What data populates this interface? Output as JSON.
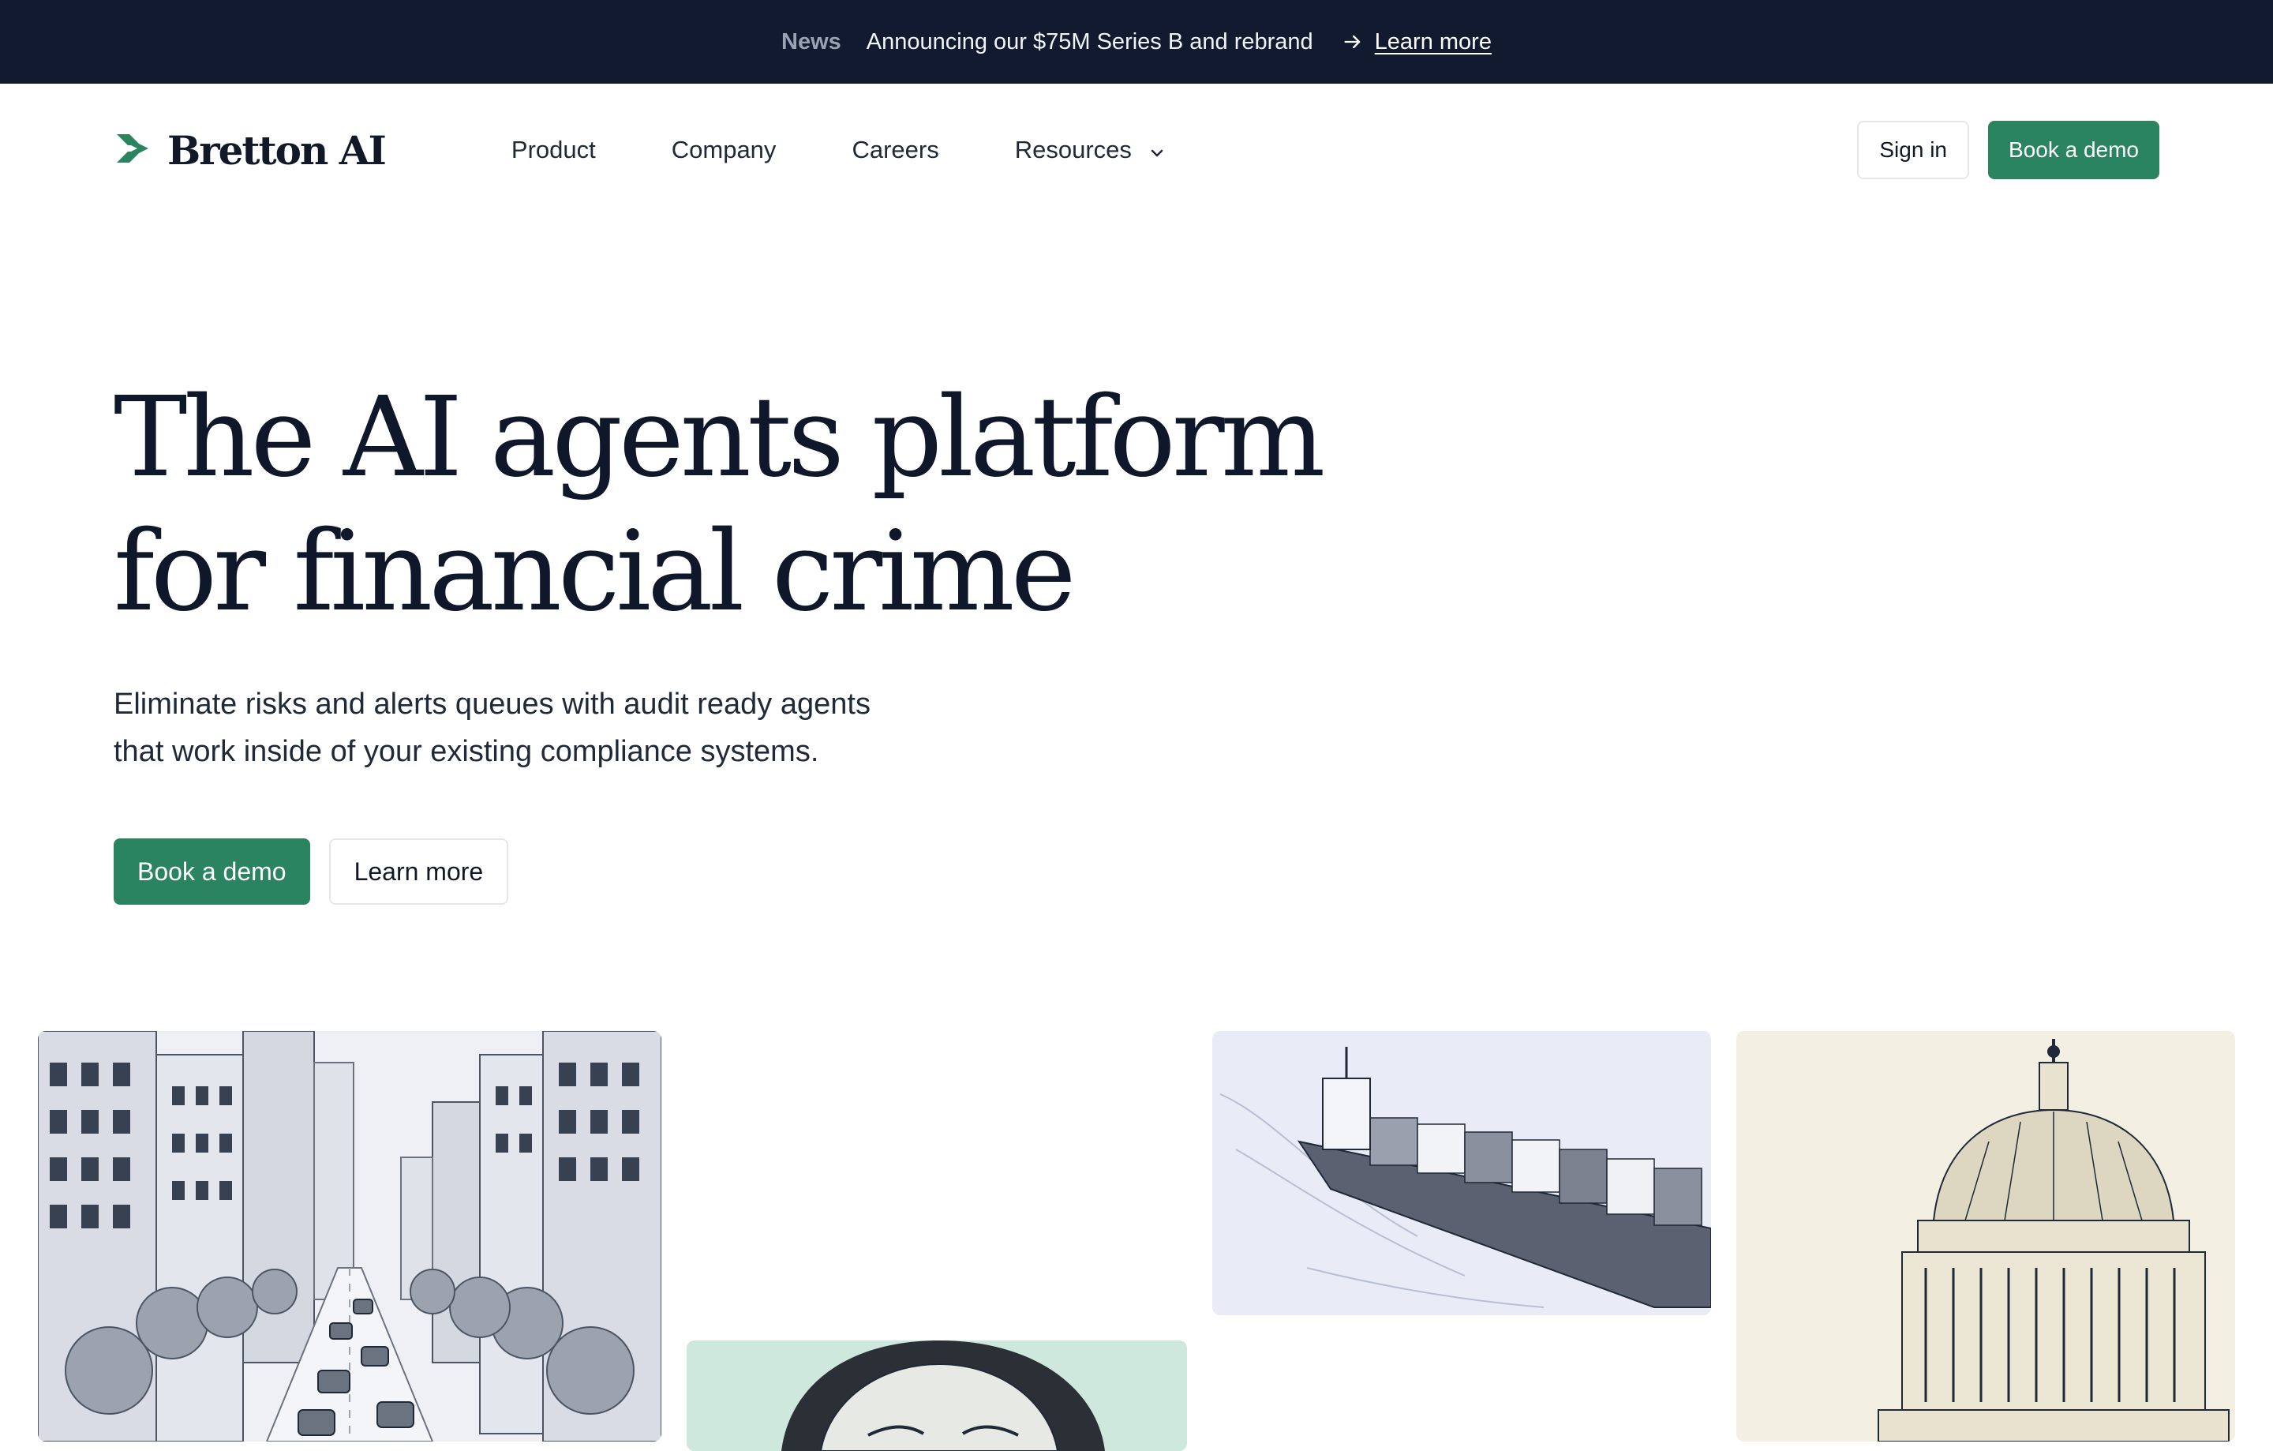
{
  "announcement": {
    "tag": "News",
    "message": "Announcing our $75M Series B and rebrand",
    "link_label": "Learn more"
  },
  "nav": {
    "brand": "Bretton AI",
    "items": [
      {
        "label": "Product"
      },
      {
        "label": "Company"
      },
      {
        "label": "Careers"
      },
      {
        "label": "Resources"
      }
    ],
    "sign_in_label": "Sign in",
    "book_demo_label": "Book a demo"
  },
  "hero": {
    "title_line1": "The AI agents platform",
    "title_line2": "for financial crime",
    "subtitle_line1": "Eliminate risks and alerts queues with audit ready agents",
    "subtitle_line2": "that work inside of your existing compliance systems.",
    "primary_cta": "Book a demo",
    "secondary_cta": "Learn more"
  },
  "images": [
    {
      "name": "city-street-illustration"
    },
    {
      "name": "portrait-illustration"
    },
    {
      "name": "cargo-ship-illustration"
    },
    {
      "name": "capitol-dome-illustration"
    }
  ],
  "colors": {
    "brand_green": "#2b8460",
    "announcement_bg": "#111a2e",
    "text_dark": "#0f172a"
  }
}
